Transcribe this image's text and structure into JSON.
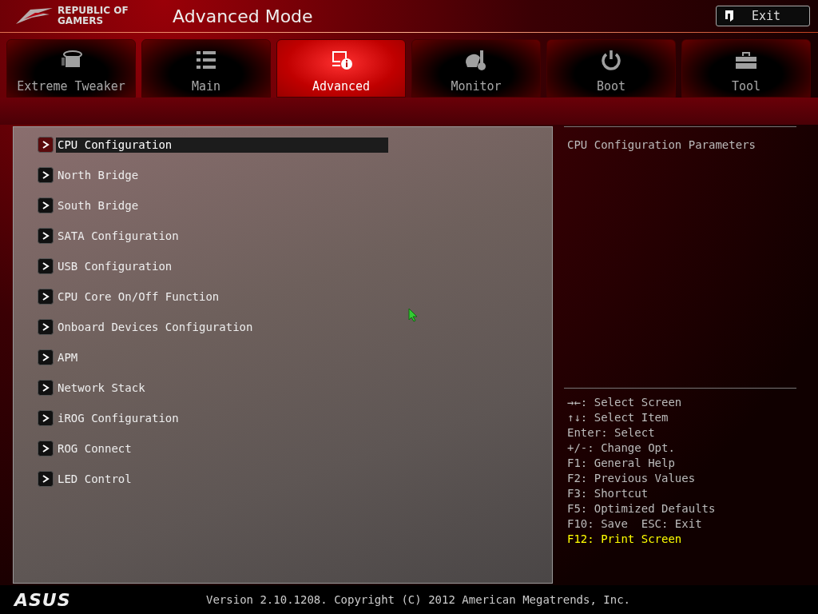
{
  "header": {
    "brand_line_1": "REPUBLIC OF",
    "brand_line_2": "GAMERS",
    "title": "Advanced Mode",
    "exit_button": "Exit"
  },
  "tabs": [
    {
      "label": "Extreme Tweaker",
      "kind": "tweaker",
      "selected": false
    },
    {
      "label": "Main",
      "kind": "list",
      "selected": false
    },
    {
      "label": "Advanced",
      "kind": "advanced",
      "selected": true
    },
    {
      "label": "Monitor",
      "kind": "gauge",
      "selected": false
    },
    {
      "label": "Boot",
      "kind": "power",
      "selected": false
    },
    {
      "label": "Tool",
      "kind": "toolbox",
      "selected": false
    }
  ],
  "menu_items": [
    {
      "label": "CPU Configuration",
      "selected": true
    },
    {
      "label": "North Bridge",
      "selected": false
    },
    {
      "label": "South Bridge",
      "selected": false
    },
    {
      "label": "SATA Configuration",
      "selected": false
    },
    {
      "label": "USB Configuration",
      "selected": false
    },
    {
      "label": "CPU Core On/Off Function",
      "selected": false
    },
    {
      "label": "Onboard Devices Configuration",
      "selected": false
    },
    {
      "label": "APM",
      "selected": false
    },
    {
      "label": "Network Stack",
      "selected": false
    },
    {
      "label": "iROG Configuration",
      "selected": false
    },
    {
      "label": "ROG Connect",
      "selected": false
    },
    {
      "label": "LED Control",
      "selected": false
    }
  ],
  "help_text": "CPU Configuration Parameters",
  "key_legend": [
    {
      "text": "→←: Select Screen",
      "kind": "normal"
    },
    {
      "text": "↑↓: Select Item",
      "kind": "normal"
    },
    {
      "text": "Enter: Select",
      "kind": "normal"
    },
    {
      "text": "+/-: Change Opt.",
      "kind": "normal"
    },
    {
      "text": "F1: General Help",
      "kind": "normal"
    },
    {
      "text": "F2: Previous Values",
      "kind": "normal"
    },
    {
      "text": "F3: Shortcut",
      "kind": "normal"
    },
    {
      "text": "F5: Optimized Defaults",
      "kind": "normal"
    },
    {
      "text": "F10: Save  ESC: Exit",
      "kind": "normal"
    },
    {
      "text": "F12: Print Screen",
      "kind": "highlight"
    }
  ],
  "footer": {
    "logo": "ASUS",
    "version": "Version 2.10.1208. Copyright (C) 2012 American Megatrends, Inc."
  }
}
